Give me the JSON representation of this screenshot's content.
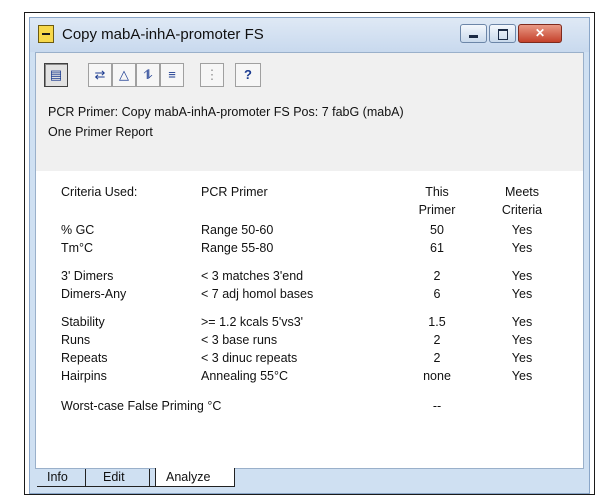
{
  "window": {
    "title": "Copy mabA-inhA-promoter FS",
    "caption_buttons": {
      "minimize": "",
      "maximize": "",
      "close": "✕"
    }
  },
  "toolbar": {
    "buttons": [
      {
        "name": "document-icon",
        "glyph": "▤"
      },
      {
        "name": "swap-arrows-icon",
        "glyph": "⇄"
      },
      {
        "name": "warning-triangle-icon",
        "glyph": "△"
      },
      {
        "name": "twist-arrows-icon",
        "glyph": "⥮"
      },
      {
        "name": "equal-lines-icon",
        "glyph": "≡"
      },
      {
        "name": "search-sequence-icon",
        "glyph": "⋮"
      },
      {
        "name": "help-icon",
        "glyph": "?"
      }
    ]
  },
  "report": {
    "line1": "PCR Primer:  Copy mabA-inhA-promoter FS   Pos: 7   fabG (mabA)",
    "line2": "One Primer Report"
  },
  "table": {
    "headers": {
      "criteria": "Criteria Used:",
      "primer": "PCR Primer",
      "this_primer_1": "This",
      "this_primer_2": "Primer",
      "meets_1": "Meets",
      "meets_2": "Criteria"
    },
    "rows": [
      {
        "criteria": "% GC",
        "desc": "Range 50-60",
        "value": "50",
        "meets": "Yes"
      },
      {
        "criteria": "Tm°C",
        "desc": "Range 55-80",
        "value": "61",
        "meets": "Yes"
      },
      {
        "criteria": "3' Dimers",
        "desc": "< 3 matches 3'end",
        "value": "2",
        "meets": "Yes"
      },
      {
        "criteria": "Dimers-Any",
        "desc": "< 7 adj homol bases",
        "value": "6",
        "meets": "Yes"
      },
      {
        "criteria": "Stability",
        "desc": ">= 1.2 kcals 5'vs3'",
        "value": "1.5",
        "meets": "Yes"
      },
      {
        "criteria": "Runs",
        "desc": "< 3 base runs",
        "value": "2",
        "meets": "Yes"
      },
      {
        "criteria": "Repeats",
        "desc": "< 3 dinuc repeats",
        "value": "2",
        "meets": "Yes"
      },
      {
        "criteria": "Hairpins",
        "desc": "Annealing 55°C",
        "value": "none",
        "meets": "Yes"
      }
    ],
    "worst_case": {
      "label": "Worst-case False Priming °C",
      "value": "--"
    }
  },
  "tabs": [
    "Info",
    "Edit",
    "Analyze"
  ],
  "colors": {
    "frame": "#cfe0f2",
    "close": "#c4412b",
    "panel": "#f0f0f0"
  }
}
